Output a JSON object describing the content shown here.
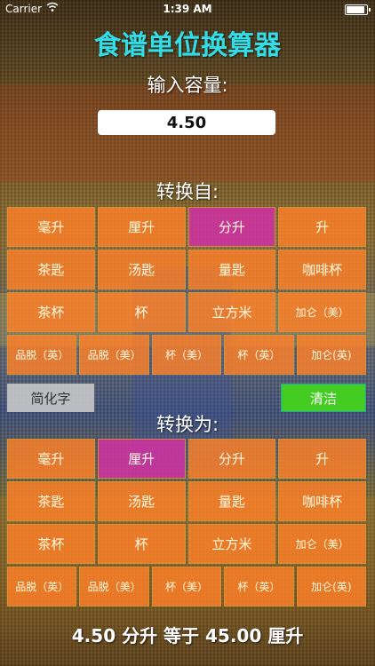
{
  "status": {
    "carrier": "Carrier",
    "time": "1:39 AM"
  },
  "title": "食谱单位换算器",
  "input_label": "输入容量:",
  "input_value": "4.50",
  "from_label": "转换自:",
  "to_label": "转换为:",
  "from_units": [
    [
      "毫升",
      "厘升",
      "分升",
      "升"
    ],
    [
      "茶匙",
      "汤匙",
      "量匙",
      "咖啡杯"
    ],
    [
      "茶杯",
      "杯",
      "立方米",
      "加仑（美）"
    ],
    [
      "品脱（英）",
      "品脱（美）",
      "杯（美）",
      "杯（英）",
      "加仑(英)"
    ]
  ],
  "to_units": [
    [
      "毫升",
      "厘升",
      "分升",
      "升"
    ],
    [
      "茶匙",
      "汤匙",
      "量匙",
      "咖啡杯"
    ],
    [
      "茶杯",
      "杯",
      "立方米",
      "加仑（美）"
    ],
    [
      "品脱（英）",
      "品脱（美）",
      "杯（美）",
      "杯（英）",
      "加仑(英)"
    ]
  ],
  "from_selected": "分升",
  "to_selected": "厘升",
  "simplified_button": "简化字",
  "clear_button": "清洁",
  "result_text": "4.50 分升 等于 45.00 厘升"
}
